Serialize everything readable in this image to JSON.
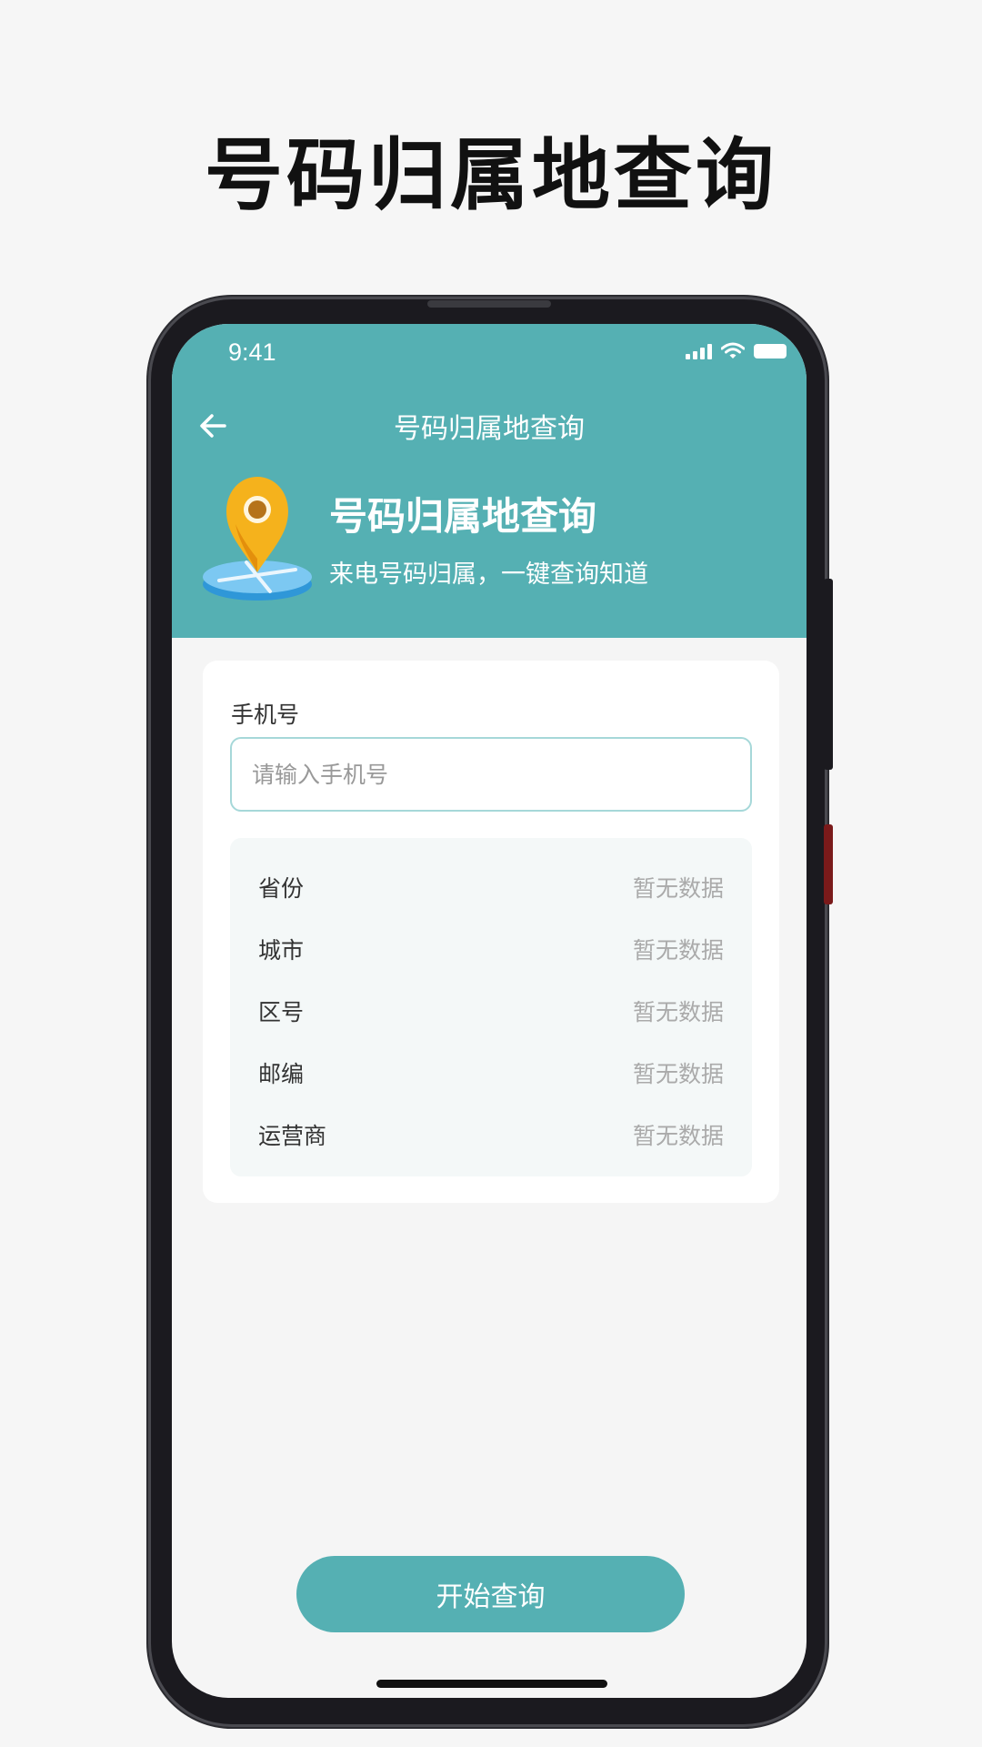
{
  "promo": {
    "title": "号码归属地查询"
  },
  "status_bar": {
    "time": "9:41",
    "icons": [
      "signal-icon",
      "wifi-icon",
      "battery-icon"
    ]
  },
  "nav": {
    "back_icon": "arrow-left-icon",
    "title": "号码归属地查询"
  },
  "hero": {
    "icon": "location-pin-icon",
    "title": "号码归属地查询",
    "subtitle": "来电号码归属，一键查询知道"
  },
  "form": {
    "label": "手机号",
    "placeholder": "请输入手机号",
    "value": ""
  },
  "results": [
    {
      "key": "省份",
      "value": "暂无数据"
    },
    {
      "key": "城市",
      "value": "暂无数据"
    },
    {
      "key": "区号",
      "value": "暂无数据"
    },
    {
      "key": "邮编",
      "value": "暂无数据"
    },
    {
      "key": "运营商",
      "value": "暂无数据"
    }
  ],
  "button": {
    "label": "开始查询"
  },
  "colors": {
    "accent": "#55b0b3",
    "background": "#f5f5f5",
    "input_border": "#a6d8d9",
    "placeholder": "#999999",
    "empty_value": "#aaaaaa"
  }
}
